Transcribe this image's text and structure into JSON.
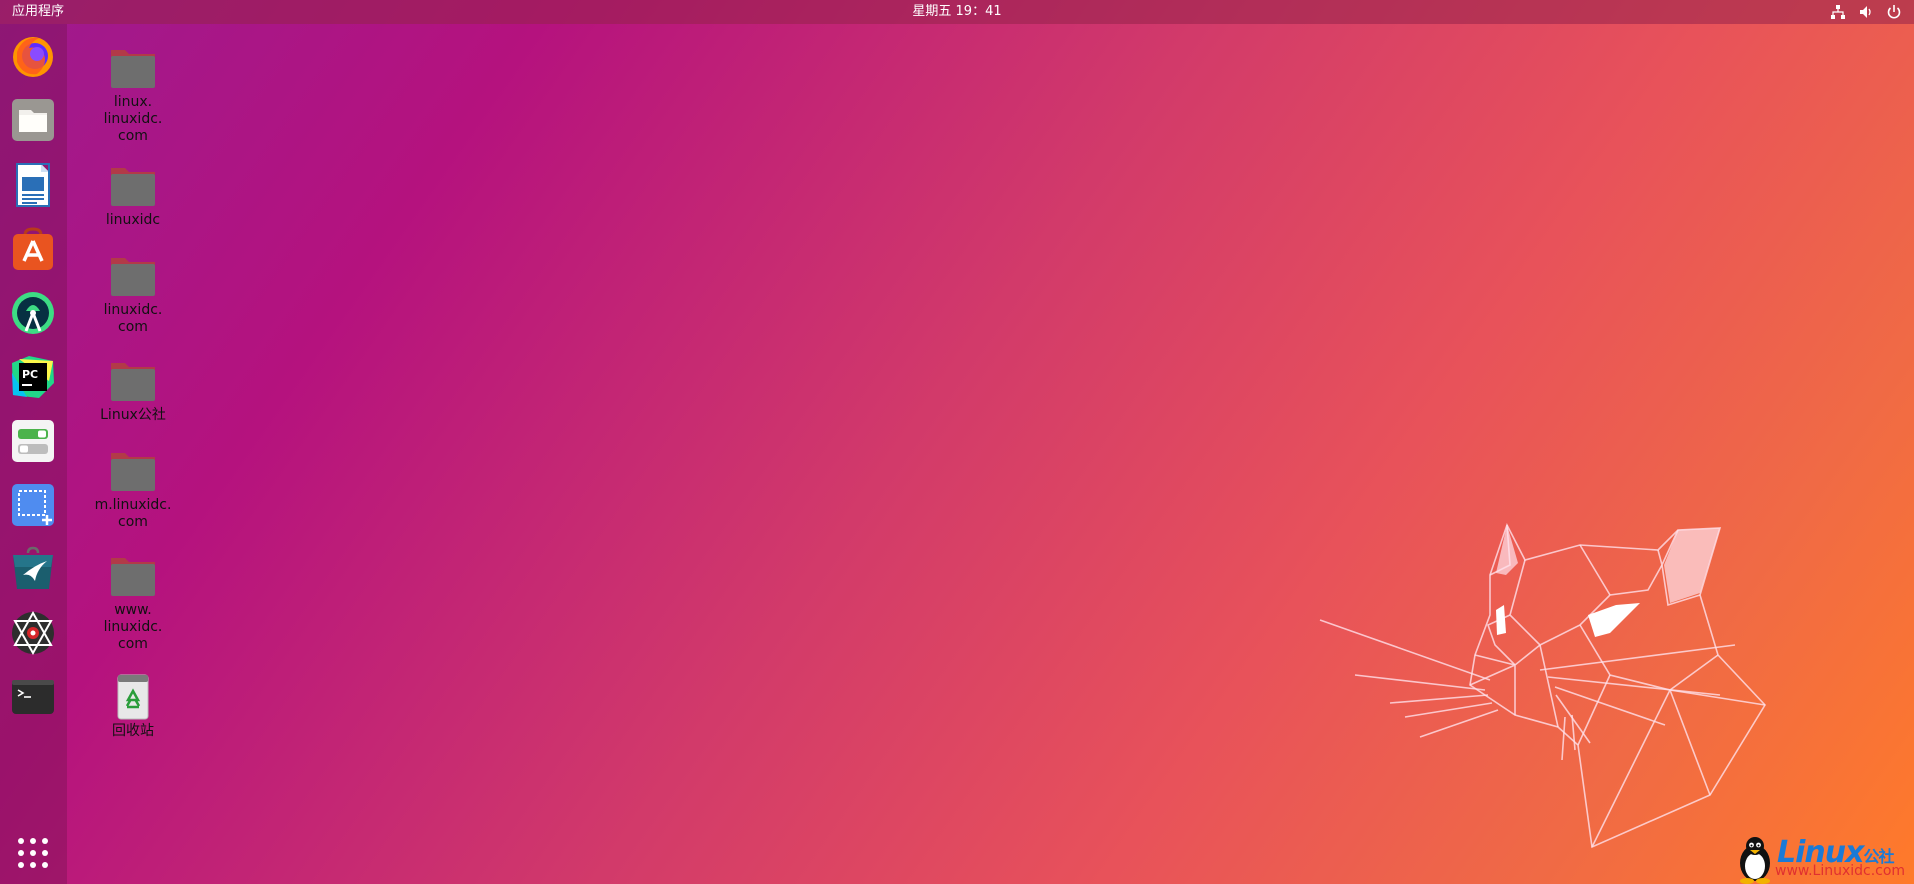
{
  "topbar": {
    "activities_label": "应用程序",
    "clock": "星期五 19：41",
    "tray_icons": [
      "network-icon",
      "volume-icon",
      "power-icon"
    ]
  },
  "dock": {
    "apps": [
      {
        "name": "Firefox",
        "icon": "firefox-icon"
      },
      {
        "name": "Files",
        "icon": "files-icon"
      },
      {
        "name": "LibreOffice Writer",
        "icon": "writer-icon"
      },
      {
        "name": "Ubuntu Software",
        "icon": "software-icon"
      },
      {
        "name": "Android Studio",
        "icon": "android-studio-icon"
      },
      {
        "name": "PyCharm",
        "icon": "pycharm-icon"
      },
      {
        "name": "Settings Toggle",
        "icon": "tweaks-icon"
      },
      {
        "name": "Screenshot",
        "icon": "screenshot-icon"
      },
      {
        "name": "App Store",
        "icon": "store-icon"
      },
      {
        "name": "Network Tool",
        "icon": "web-icon"
      },
      {
        "name": "Terminal",
        "icon": "terminal-icon"
      }
    ],
    "show_apps_icon": "grid-icon"
  },
  "desktop": {
    "items": [
      {
        "label": "linux.\nlinuxidc.\ncom",
        "type": "folder"
      },
      {
        "label": "linuxidc",
        "type": "folder"
      },
      {
        "label": "linuxidc.\ncom",
        "type": "folder"
      },
      {
        "label": "Linux公社",
        "type": "folder"
      },
      {
        "label": "m.linuxidc.\ncom",
        "type": "folder"
      },
      {
        "label": "www.\nlinuxidc.\ncom",
        "type": "folder"
      },
      {
        "label": "回收站",
        "type": "trash"
      }
    ]
  },
  "watermark": {
    "brand": "Linux",
    "suffix": "公社",
    "url": "www.Linuxidc.com"
  },
  "colors": {
    "folder_body": "#6e6e6e",
    "folder_tab": "#c04040",
    "accent_orange": "#e95420"
  }
}
